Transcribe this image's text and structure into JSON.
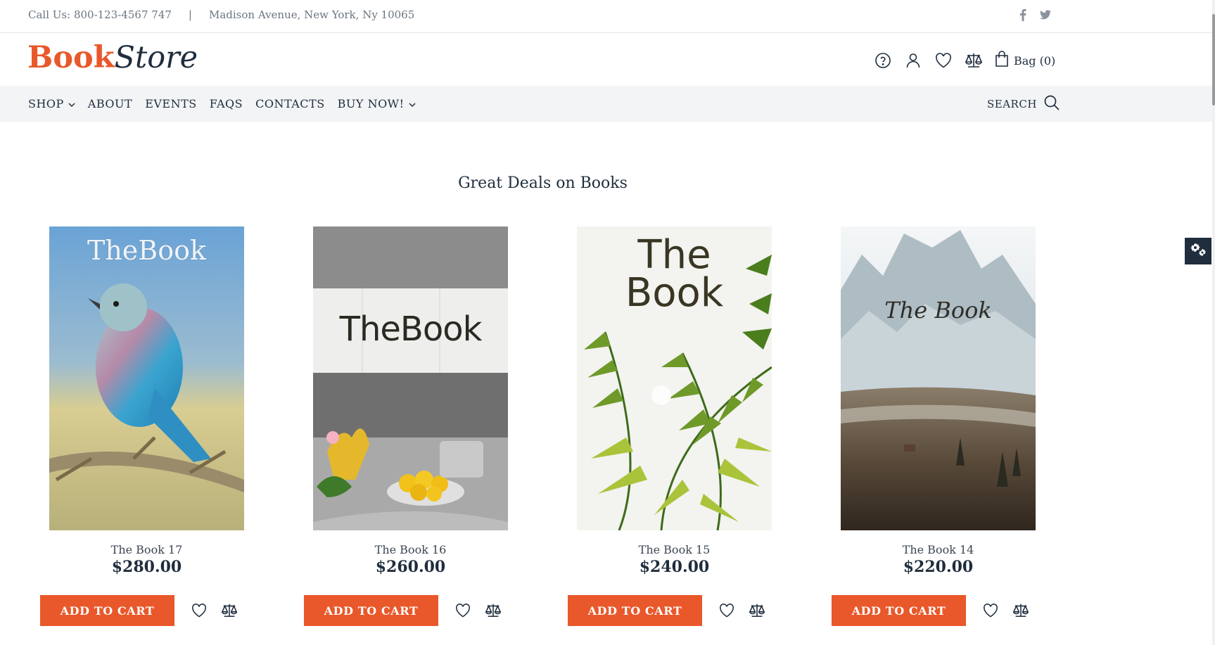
{
  "topbar": {
    "phone": "Call Us: 800-123-4567 747",
    "separator": "|",
    "address": "Madison Avenue, New York, Ny 10065",
    "social": [
      "facebook-icon",
      "twitter-icon"
    ]
  },
  "header": {
    "logo_part1": "Book",
    "logo_part2": "Store",
    "icons": [
      "help-icon",
      "user-icon",
      "heart-icon",
      "compare-icon",
      "bag-icon"
    ],
    "bag_label": "Bag (0)"
  },
  "nav": {
    "items": [
      {
        "label": "SHOP",
        "has_dropdown": true
      },
      {
        "label": "ABOUT",
        "has_dropdown": false
      },
      {
        "label": "EVENTS",
        "has_dropdown": false
      },
      {
        "label": "FAQS",
        "has_dropdown": false
      },
      {
        "label": "CONTACTS",
        "has_dropdown": false
      },
      {
        "label": "BUY NOW!",
        "has_dropdown": true
      }
    ],
    "search_label": "SEARCH"
  },
  "section": {
    "title": "Great Deals on Books"
  },
  "products": [
    {
      "name": "The Book 17",
      "price": "$280.00",
      "cover_text": "TheBook",
      "button": "ADD TO CART"
    },
    {
      "name": "The Book 16",
      "price": "$260.00",
      "cover_text": "TheBook",
      "button": "ADD TO CART"
    },
    {
      "name": "The Book 15",
      "price": "$240.00",
      "cover_line1": "The",
      "cover_line2": "Book",
      "button": "ADD TO CART"
    },
    {
      "name": "The Book 14",
      "price": "$220.00",
      "cover_text": "The Book",
      "button": "ADD TO CART"
    }
  ],
  "colors": {
    "accent": "#e9582a",
    "dark": "#1f2d3d",
    "nav_bg": "#f2f4f6"
  }
}
